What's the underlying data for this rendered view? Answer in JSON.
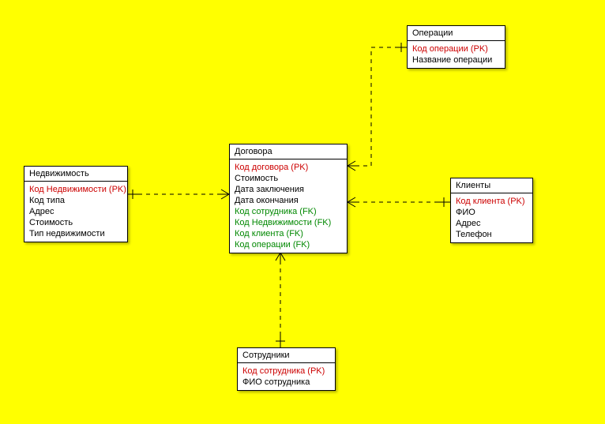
{
  "entities": {
    "nedvizhimost": {
      "title": "Недвижимость",
      "fields": [
        {
          "text": "Код Недвижимости (PK)",
          "type": "pk"
        },
        {
          "text": "Код типа",
          "type": "normal"
        },
        {
          "text": "Адрес",
          "type": "normal"
        },
        {
          "text": "Стоимость",
          "type": "normal"
        },
        {
          "text": "Тип недвижимости",
          "type": "normal"
        }
      ]
    },
    "dogovora": {
      "title": "Договора",
      "fields": [
        {
          "text": "Код договора (PK)",
          "type": "pk"
        },
        {
          "text": "Стоимость",
          "type": "normal"
        },
        {
          "text": "Дата заключения",
          "type": "normal"
        },
        {
          "text": "Дата окончания",
          "type": "normal"
        },
        {
          "text": "Код сотрудника (FK)",
          "type": "fk"
        },
        {
          "text": "Код Недвижимости (FK)",
          "type": "fk"
        },
        {
          "text": "Код клиента (FK)",
          "type": "fk"
        },
        {
          "text": "Код операции (FK)",
          "type": "fk"
        }
      ]
    },
    "operacii": {
      "title": "Операции",
      "fields": [
        {
          "text": "Код операции (PK)",
          "type": "pk"
        },
        {
          "text": "Название операции",
          "type": "normal"
        }
      ]
    },
    "klienty": {
      "title": "Клиенты",
      "fields": [
        {
          "text": "Код клиента (PK)",
          "type": "pk"
        },
        {
          "text": "ФИО",
          "type": "normal"
        },
        {
          "text": "Адрес",
          "type": "normal"
        },
        {
          "text": "Телефон",
          "type": "normal"
        }
      ]
    },
    "sotrudniki": {
      "title": "Сотрудники",
      "fields": [
        {
          "text": "Код сотрудника (PK)",
          "type": "pk"
        },
        {
          "text": "ФИО сотрудника",
          "type": "normal"
        }
      ]
    }
  }
}
